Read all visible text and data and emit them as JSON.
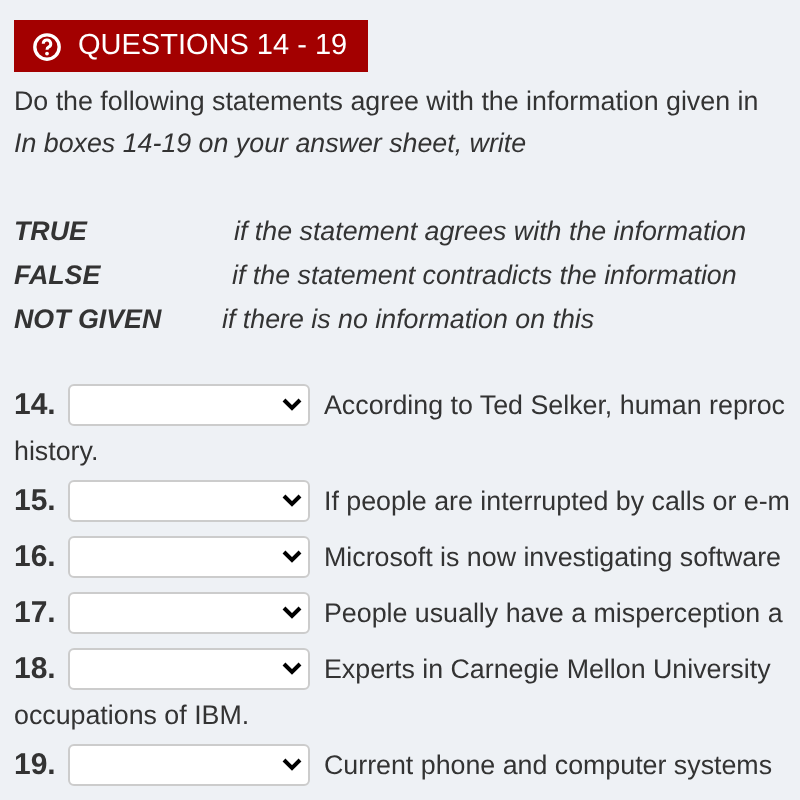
{
  "header": {
    "title": "QUESTIONS 14 - 19"
  },
  "instruction": "Do the following statements agree with the information given in",
  "sub_instruction": "In boxes 14-19 on your answer sheet, write",
  "legend": [
    {
      "term": "TRUE",
      "meaning": "if the statement agrees with the information"
    },
    {
      "term": "FALSE",
      "meaning": "if the statement contradicts the information"
    },
    {
      "term": "NOT GIVEN",
      "meaning": "if there is no information on this"
    }
  ],
  "questions": [
    {
      "number": "14.",
      "text": "According to Ted Selker, human reproc",
      "continuation": "history."
    },
    {
      "number": "15.",
      "text": "If people are interrupted by calls or e-m"
    },
    {
      "number": "16.",
      "text": "Microsoft is now investigating software"
    },
    {
      "number": "17.",
      "text": "People usually have a misperception a"
    },
    {
      "number": "18.",
      "text": "Experts in Carnegie Mellon University",
      "continuation": "occupations of IBM."
    },
    {
      "number": "19.",
      "text": "Current phone and computer systems"
    }
  ]
}
